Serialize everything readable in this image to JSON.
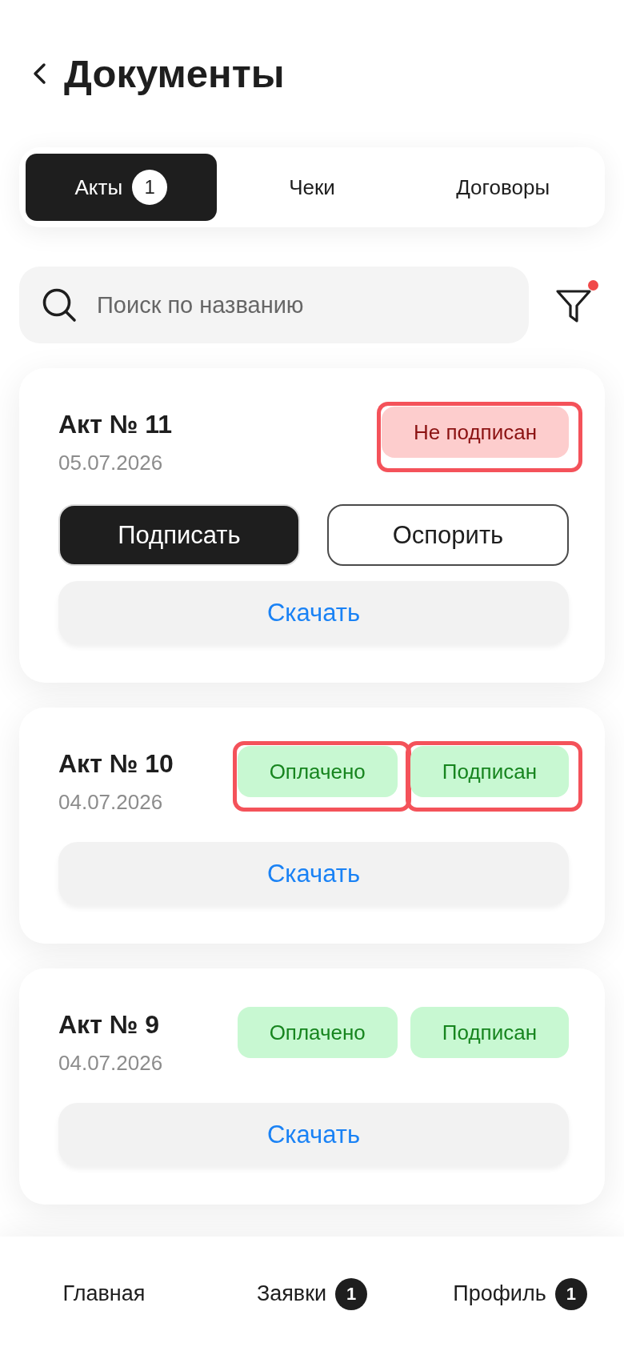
{
  "header": {
    "title": "Документы"
  },
  "tabs": [
    {
      "label": "Акты",
      "badge": "1",
      "selected": true
    },
    {
      "label": "Чеки",
      "selected": false
    },
    {
      "label": "Договоры",
      "selected": false
    }
  ],
  "search": {
    "placeholder": "Поиск по названию"
  },
  "filter": {
    "active": true
  },
  "documents": [
    {
      "title": "Акт № 11",
      "date": "05.07.2026",
      "badges": [
        {
          "label": "Не подписан",
          "kind": "negative",
          "highlighted": true
        }
      ],
      "actions": [
        {
          "label": "Подписать",
          "kind": "primary"
        },
        {
          "label": "Оспорить",
          "kind": "outline"
        }
      ],
      "download": "Скачать"
    },
    {
      "title": "Акт № 10",
      "date": "04.07.2026",
      "badges": [
        {
          "label": "Оплачено",
          "kind": "positive",
          "highlighted": true
        },
        {
          "label": "Подписан",
          "kind": "positive",
          "highlighted": true
        }
      ],
      "download": "Скачать"
    },
    {
      "title": "Акт № 9",
      "date": "04.07.2026",
      "badges": [
        {
          "label": "Оплачено",
          "kind": "positive",
          "highlighted": false
        },
        {
          "label": "Подписан",
          "kind": "positive",
          "highlighted": false
        }
      ],
      "download": "Скачать"
    }
  ],
  "bottom_nav": [
    {
      "label": "Главная"
    },
    {
      "label": "Заявки",
      "badge": "1"
    },
    {
      "label": "Профиль",
      "badge": "1"
    }
  ]
}
